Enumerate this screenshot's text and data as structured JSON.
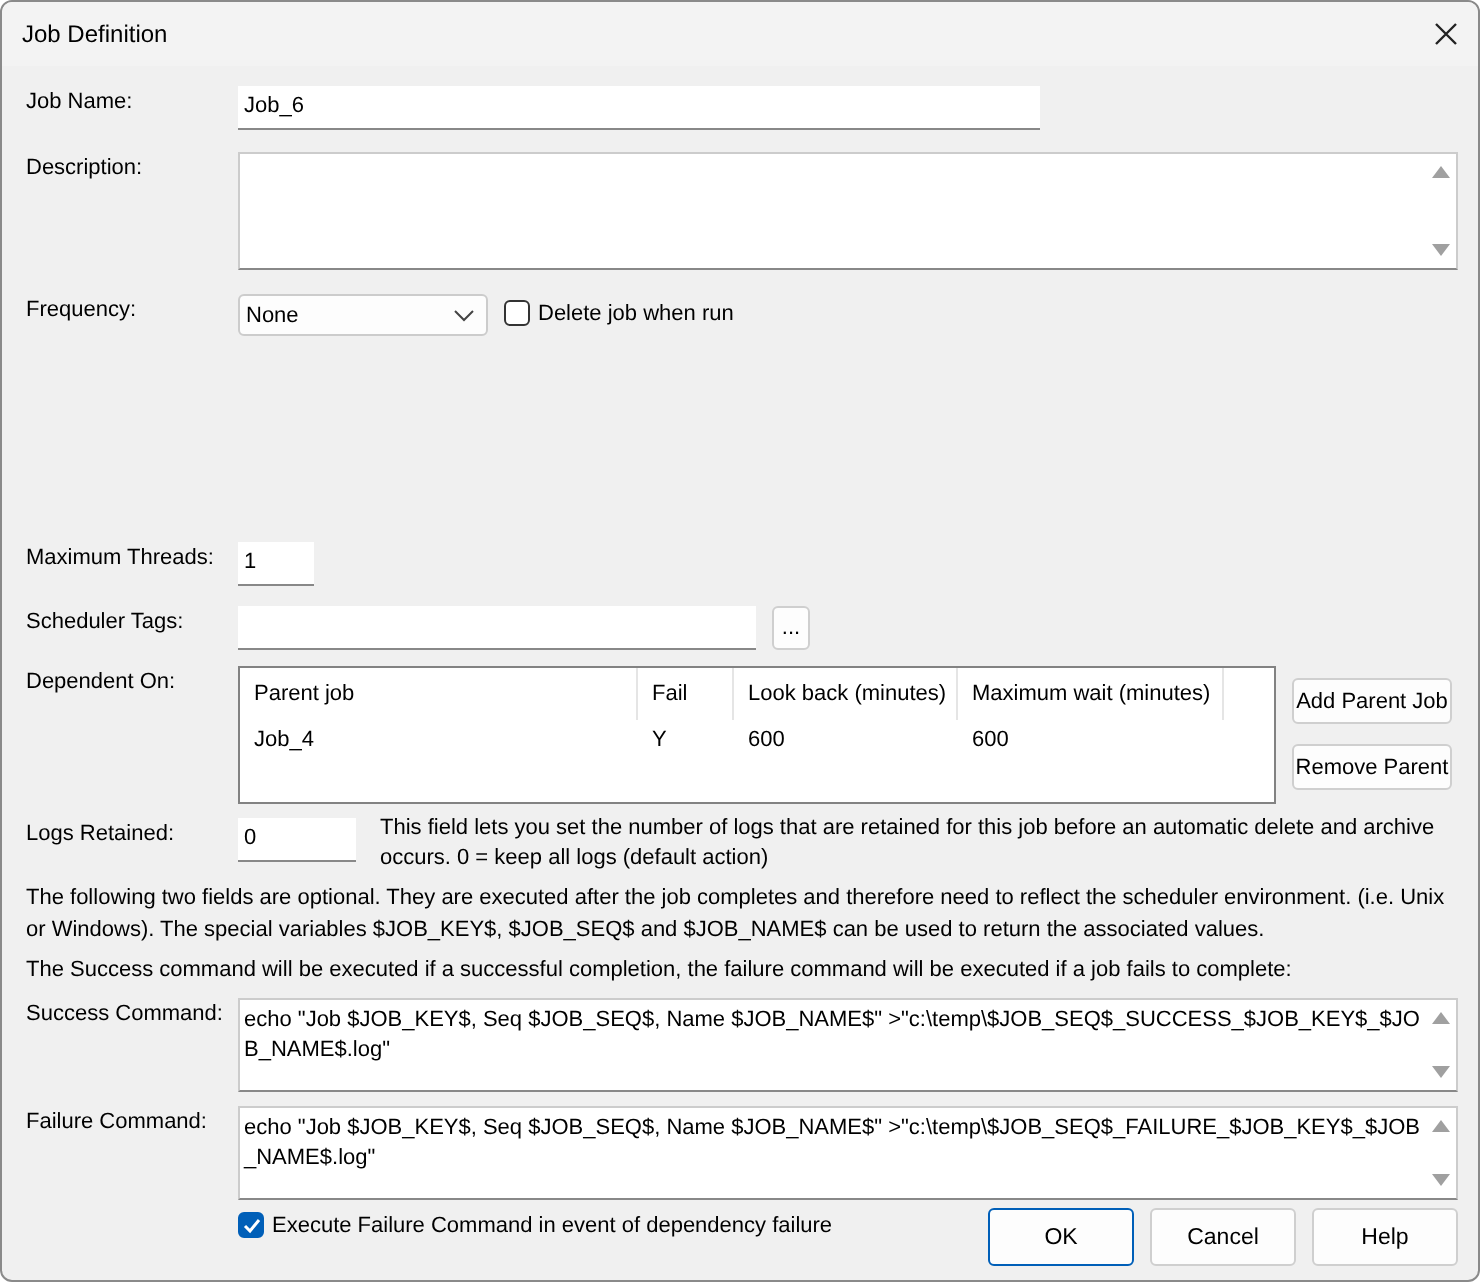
{
  "window": {
    "title": "Job Definition"
  },
  "job_name": {
    "label": "Job Name:",
    "value": "Job_6"
  },
  "description": {
    "label": "Description:"
  },
  "frequency": {
    "label": "Frequency:",
    "value": "None"
  },
  "delete_when_run": {
    "label": "Delete job when run",
    "checked": false
  },
  "maximum_threads": {
    "label": "Maximum Threads:",
    "value": "1"
  },
  "scheduler_tags": {
    "label": "Scheduler Tags:",
    "browse": "..."
  },
  "dependent_on": {
    "label": "Dependent On:",
    "columns": [
      "Parent job",
      "Fail",
      "Look back (minutes)",
      "Maximum wait (minutes)"
    ],
    "rows": [
      [
        "Job_4",
        "Y",
        "600",
        "600"
      ]
    ],
    "buttons": [
      "Add Parent Job",
      "Remove Parent"
    ]
  },
  "logs_retained": {
    "label": "Logs Retained:",
    "value": "0",
    "hint": "This field lets you set the number of logs that are retained for this job before an automatic delete and archive occurs. 0 = keep all logs (default action)"
  },
  "info": [
    "The following two fields are optional. They are executed after the job completes and therefore need to reflect the scheduler environment. (i.e. Unix or Windows). The special variables $JOB_KEY$, $JOB_SEQ$ and $JOB_NAME$ can be used to return the associated values.",
    "The Success command will be executed if a successful completion, the failure command will be executed if a job fails to complete:"
  ],
  "success_command": {
    "label": "Success Command:",
    "value": "echo \"Job $JOB_KEY$, Seq $JOB_SEQ$, Name $JOB_NAME$\" >\"c:\\temp\\$JOB_SEQ$_SUCCESS_$JOB_KEY$_$JOB_NAME$.log\""
  },
  "failure_command": {
    "label": "Failure Command:",
    "value": "echo \"Job $JOB_KEY$, Seq $JOB_SEQ$, Name $JOB_NAME$\" >\"c:\\temp\\$JOB_SEQ$_FAILURE_$JOB_KEY$_$JOB_NAME$.log\""
  },
  "execute_failure_on_dependency": {
    "label": "Execute Failure Command in event of dependency failure",
    "checked": true
  },
  "buttons": [
    {
      "label": "OK",
      "default": true
    },
    {
      "label": "Cancel",
      "default": false
    },
    {
      "label": "Help",
      "default": false
    }
  ]
}
